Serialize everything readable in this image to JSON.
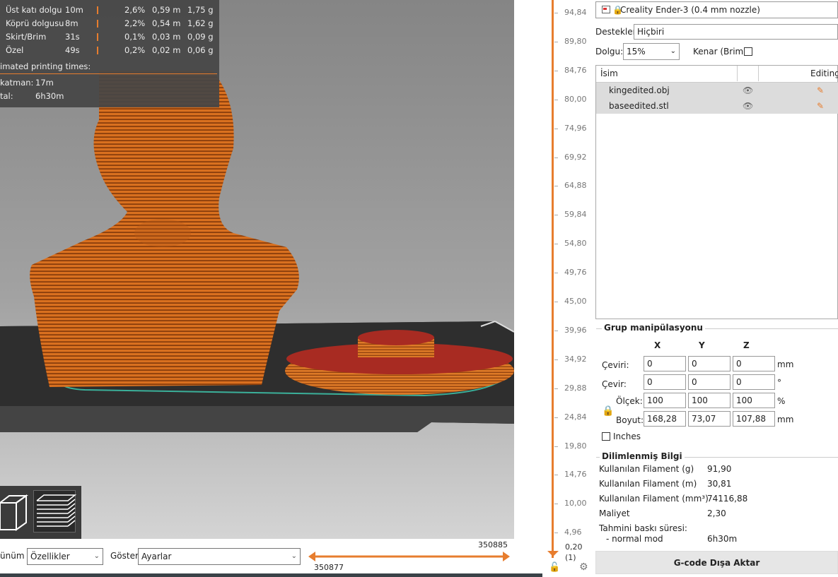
{
  "stats": {
    "rows": [
      {
        "name": "Üst katı dolgu",
        "time": "10m",
        "pct": "2,6%",
        "len": "0,59 m",
        "wt": "1,75 g"
      },
      {
        "name": "Köprü dolgusu",
        "time": "8m",
        "pct": "2,2%",
        "len": "0,54 m",
        "wt": "1,62 g"
      },
      {
        "name": "Skirt/Brim",
        "time": "31s",
        "pct": "0,1%",
        "len": "0,03 m",
        "wt": "0,09 g"
      },
      {
        "name": "Özel",
        "time": "49s",
        "pct": "0,2%",
        "len": "0,02 m",
        "wt": "0,06 g"
      }
    ],
    "est_title": "imated printing times:",
    "layer_label": "katman:",
    "layer_value": "17m",
    "total_label": "tal:",
    "total_value": "6h30m"
  },
  "bottom": {
    "view_label": "ünüm",
    "view_value": "Özellikler",
    "show_label": "Göster",
    "show_value": "Ayarlar",
    "scrub_top": "350885",
    "scrub_bottom": "350877"
  },
  "slider": {
    "ticks": [
      "94,84",
      "89,80",
      "84,76",
      "80,00",
      "74,96",
      "69,92",
      "64,88",
      "59,84",
      "54,80",
      "49,76",
      "45,00",
      "39,96",
      "34,92",
      "29,88",
      "24,84",
      "19,80",
      "14,76",
      "10,00",
      "4,96"
    ],
    "bottom_value": "0,20",
    "bottom_layer": "(1)"
  },
  "panel": {
    "printer": "Creality Ender-3 (0.4 mm nozzle)",
    "supports_label": "Destekler:",
    "supports_value": "Hiçbiri",
    "infill_label": "Dolgu:",
    "infill_value": "15%",
    "brim_label": "Kenar (Brim):",
    "col_name": "İsim",
    "col_editing": "Editing",
    "objects": [
      {
        "name": "kingedited.obj"
      },
      {
        "name": "baseedited.stl"
      }
    ],
    "group_title": "Grup manipülasyonu",
    "axis_x": "X",
    "axis_y": "Y",
    "axis_z": "Z",
    "move_label": "Çeviri:",
    "move": [
      "0",
      "0",
      "0"
    ],
    "move_unit": "mm",
    "rotate_label": "Çevir:",
    "rotate": [
      "0",
      "0",
      "0"
    ],
    "rotate_unit": "°",
    "scale_label": "Ölçek:",
    "scale": [
      "100",
      "100",
      "100"
    ],
    "scale_unit": "%",
    "size_label": "Boyut:",
    "size": [
      "168,28",
      "73,07",
      "107,88"
    ],
    "size_unit": "mm",
    "inches_label": "Inches",
    "sliced_title": "Dilimlenmiş Bilgi",
    "info": [
      {
        "k": "Kullanılan Filament (g)",
        "v": "91,90"
      },
      {
        "k": "Kullanılan Filament (m)",
        "v": "30,81"
      },
      {
        "k": "Kullanılan Filament (mm³)",
        "v": "74116,88"
      },
      {
        "k": "Maliyet",
        "v": "2,30"
      },
      {
        "k": "Tahmini baskı süresi:",
        "v": ""
      },
      {
        "k": "- normal mod",
        "v": "6h30m"
      }
    ],
    "export_label": "G-code Dışa Aktar"
  }
}
